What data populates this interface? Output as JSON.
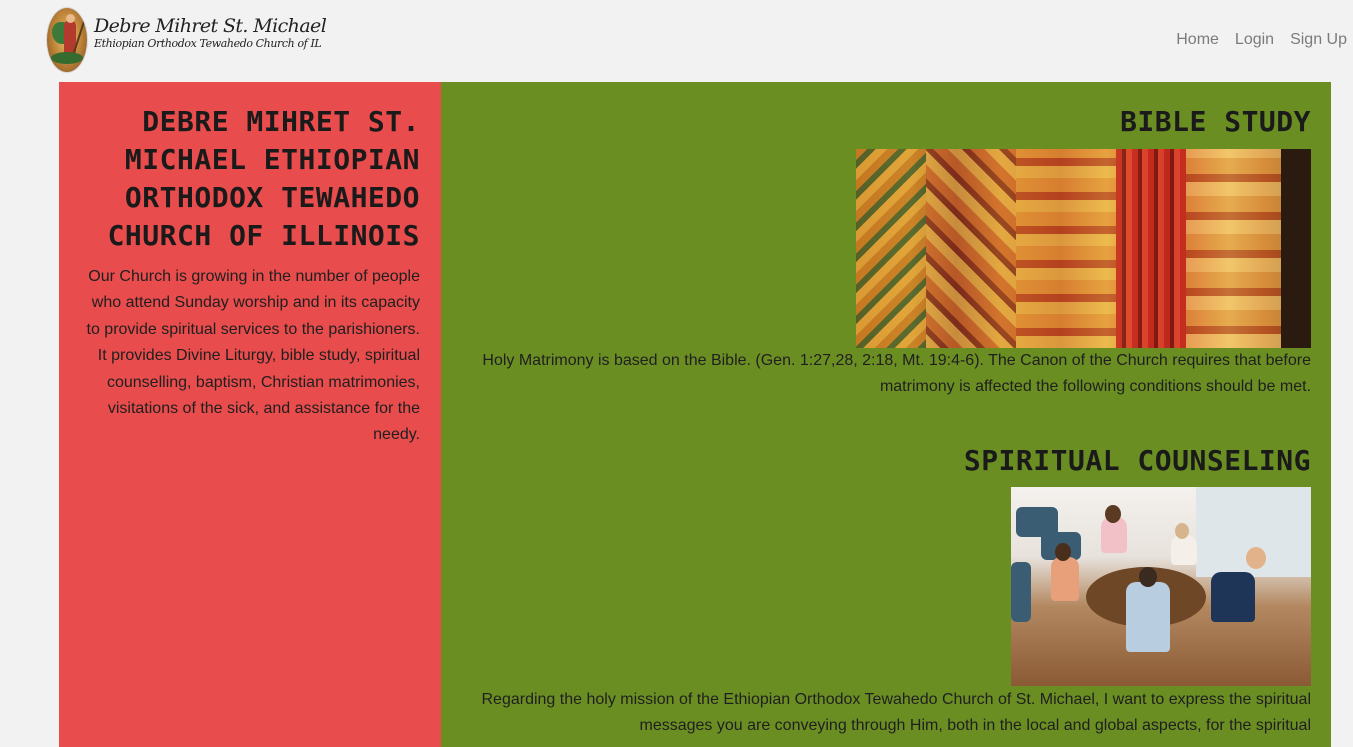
{
  "header": {
    "logo_title": "Debre Mihret St. Michael",
    "logo_subtitle": "Ethiopian Orthodox Tewahedo Church of IL",
    "nav": [
      "Home",
      "Login",
      "Sign Up"
    ]
  },
  "intro": {
    "title": "DEBRE MIHRET ST. MICHAEL ETHIOPIAN ORTHODOX TEWAHEDO CHURCH OF ILLINOIS",
    "text": "Our Church is growing in the number of people who attend Sunday worship and in its capacity to provide spiritual services to the parishioners. It provides Divine Liturgy, bible study, spiritual counselling, baptism, Christian matrimonies, visitations of the sick, and assistance for the needy."
  },
  "sections": [
    {
      "title": "BIBLE STUDY",
      "image": "ethiopian-church-mural-image",
      "text": "Holy Matrimony is based on the Bible. (Gen. 1:27,28, 2:18, Mt. 19:4-6). The Canon of the Church requires that before matrimony is affected the following conditions should be met."
    },
    {
      "title": "SPIRITUAL COUNSELING",
      "image": "group-counseling-meeting-image",
      "text": "Regarding the holy mission of the Ethiopian Orthodox Tewahedo Church of St. Michael, I want to express the spiritual messages you are conveying through Him, both in the local and global aspects, for the spiritual"
    }
  ],
  "colors": {
    "background": "#f2f2f2",
    "intro_panel": "#e84c4c",
    "sections_panel": "#6b8e23",
    "nav_link": "#7b7b7b"
  }
}
